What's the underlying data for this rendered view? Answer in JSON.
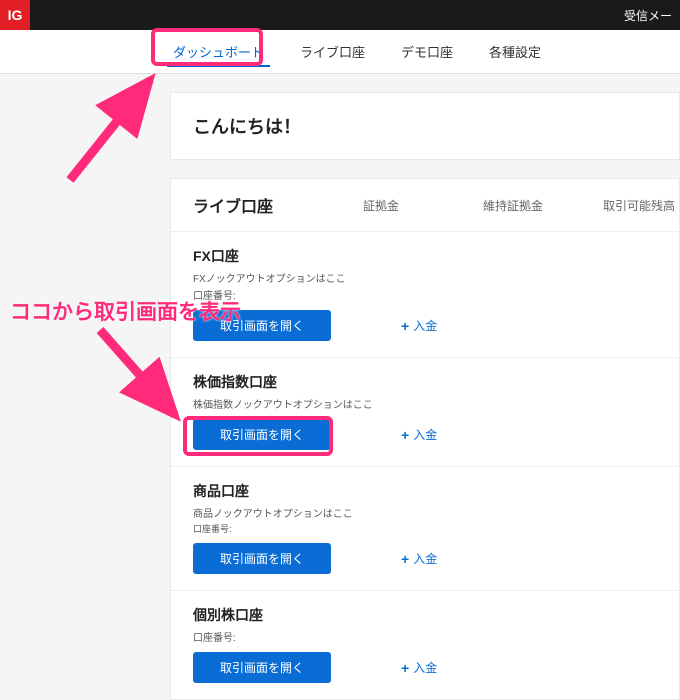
{
  "logo": "IG",
  "topbar_right": "受信メー",
  "tabs": {
    "dashboard": "ダッシュボード",
    "live": "ライブ口座",
    "demo": "デモ口座",
    "settings": "各種設定"
  },
  "greeting": "こんにちは！",
  "section": {
    "title": "ライブ口座",
    "col_margin": "証拠金",
    "col_maint": "維持証拠金",
    "col_avail": "取引可能残高"
  },
  "accounts": [
    {
      "name": "FX口座",
      "sub1": "FXノックアウトオプションはここ",
      "sub2": "口座番号:",
      "btn": "取引画面を開く",
      "deposit": "入金"
    },
    {
      "name": "株価指数口座",
      "sub1": "株価指数ノックアウトオプションはここ",
      "sub2": "",
      "btn": "取引画面を開く",
      "deposit": "入金"
    },
    {
      "name": "商品口座",
      "sub1": "商品ノックアウトオプションはここ",
      "sub2": "口座番号:",
      "btn": "取引画面を開く",
      "deposit": "入金"
    },
    {
      "name": "個別株口座",
      "sub1": "",
      "sub2": "口座番号:",
      "btn": "取引画面を開く",
      "deposit": "入金"
    }
  ],
  "annotation": "ココから取引画面を表示"
}
